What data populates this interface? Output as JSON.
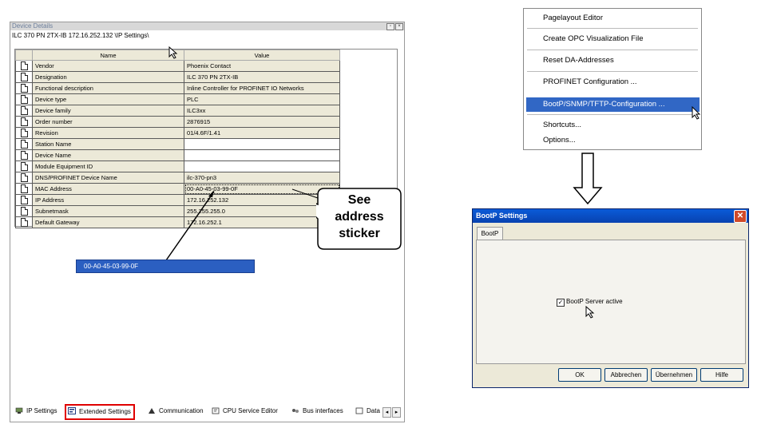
{
  "device_details": {
    "title": "Device Details",
    "path": "ILC 370 PN 2TX-IB 172.16.252.132 \\IP Settings\\",
    "columns": [
      "Name",
      "Value"
    ],
    "rows": [
      {
        "name": "Vendor",
        "value": "Phoenix Contact"
      },
      {
        "name": "Designation",
        "value": "ILC 370 PN 2TX-IB"
      },
      {
        "name": "Functional description",
        "value": "Inline Controller for PROFINET IO Networks"
      },
      {
        "name": "Device type",
        "value": "PLC"
      },
      {
        "name": "Device family",
        "value": "ILC3xx"
      },
      {
        "name": "Order number",
        "value": "2876915"
      },
      {
        "name": "Revision",
        "value": "01/4.6F/1.41"
      },
      {
        "name": "Station Name",
        "value": ""
      },
      {
        "name": "Device Name",
        "value": ""
      },
      {
        "name": "Module Equipment ID",
        "value": ""
      },
      {
        "name": "DNS/PROFINET Device Name",
        "value": "ilc-370-pn3"
      },
      {
        "name": "MAC Address",
        "value": "00-A0-45-03-99-0F"
      },
      {
        "name": "IP Address",
        "value": "172.16.252.132"
      },
      {
        "name": "Subnetmask",
        "value": "255.255.255.0"
      },
      {
        "name": "Default Gateway",
        "value": "172.16.252.1"
      }
    ],
    "mac_highlight": "00-A0-45-03-99-0F",
    "tabs": [
      "IP Settings",
      "Extended Settings",
      "Communication",
      "CPU Service Editor",
      "Bus interfaces",
      "Data"
    ]
  },
  "callout": {
    "line1": "See",
    "line2": "address",
    "line3": "sticker"
  },
  "context_menu": {
    "items": [
      "Pagelayout Editor",
      "Create OPC Visualization File",
      "Reset DA-Addresses",
      "PROFINET Configuration ...",
      "BootP/SNMP/TFTP-Configuration ...",
      "Shortcuts...",
      "Options..."
    ],
    "selected_index": 4
  },
  "bootp_dialog": {
    "title": "BootP Settings",
    "tab": "BootP",
    "checkbox_label": "BootP Server active",
    "checkbox_checked": true,
    "buttons": {
      "ok": "OK",
      "cancel": "Abbrechen",
      "apply": "Übernehmen",
      "help": "Hilfe"
    }
  },
  "colors": {
    "selection": "#3167c5",
    "highlight_border": "#e00000",
    "dialog_title": "#0a5bd8"
  }
}
